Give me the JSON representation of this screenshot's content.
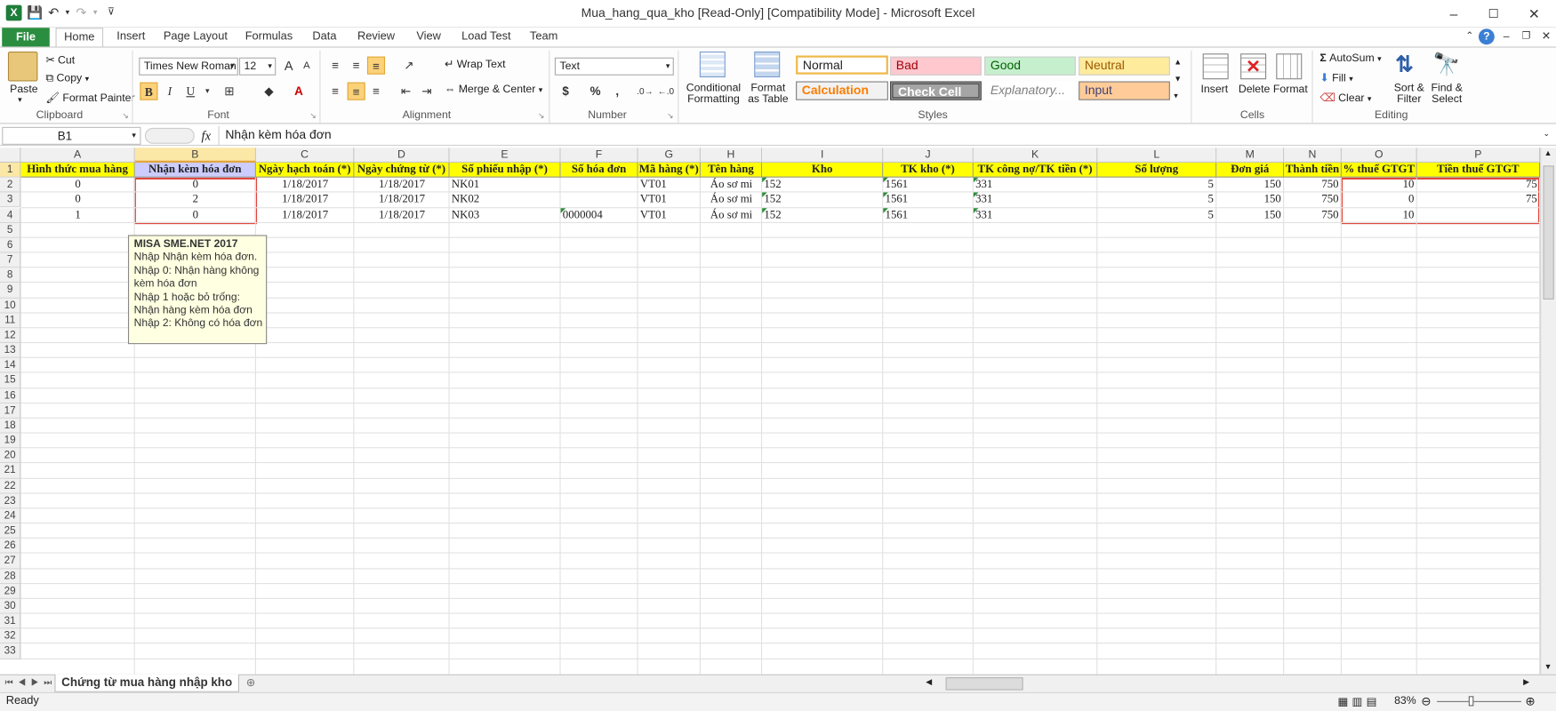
{
  "window": {
    "title": "Mua_hang_qua_kho  [Read-Only]  [Compatibility Mode]  -  Microsoft Excel"
  },
  "tabs": [
    "File",
    "Home",
    "Insert",
    "Page Layout",
    "Formulas",
    "Data",
    "Review",
    "View",
    "Load Test",
    "Team"
  ],
  "ribbon": {
    "clipboard": {
      "paste": "Paste",
      "cut": "Cut",
      "copy": "Copy",
      "format_painter": "Format Painter",
      "label": "Clipboard"
    },
    "font": {
      "name": "Times New Roman",
      "size": "12",
      "bold": "B",
      "italic": "I",
      "underline": "U",
      "label": "Font"
    },
    "alignment": {
      "wrap_text": "Wrap Text",
      "merge_center": "Merge & Center",
      "label": "Alignment"
    },
    "number": {
      "format": "Text",
      "currency": "$",
      "percent": "%",
      "comma": ",",
      "label": "Number"
    },
    "styles": {
      "conditional": "Conditional",
      "conditional2": "Formatting",
      "format_as": "Format",
      "format_as2": "as Table",
      "normal": "Normal",
      "bad": "Bad",
      "good": "Good",
      "neutral": "Neutral",
      "calculation": "Calculation",
      "check_cell": "Check Cell",
      "explanatory": "Explanatory...",
      "input": "Input",
      "label": "Styles"
    },
    "cells": {
      "insert": "Insert",
      "delete": "Delete",
      "format": "Format",
      "label": "Cells"
    },
    "editing": {
      "autosum": "AutoSum",
      "fill": "Fill",
      "clear": "Clear",
      "sort": "Sort &",
      "sort2": "Filter",
      "find": "Find &",
      "find2": "Select",
      "label": "Editing"
    }
  },
  "formula_bar": {
    "name_box": "B1",
    "fx": "fx",
    "content": "Nhận kèm hóa đơn"
  },
  "columns": [
    "A",
    "B",
    "C",
    "D",
    "E",
    "F",
    "G",
    "H",
    "I",
    "J",
    "K",
    "L",
    "M",
    "N",
    "O",
    "P"
  ],
  "rows": [
    "1",
    "2",
    "3",
    "4",
    "5",
    "6",
    "7",
    "8",
    "9",
    "10",
    "11",
    "12",
    "13",
    "14",
    "15",
    "16",
    "17",
    "18",
    "19",
    "20",
    "21",
    "22",
    "23",
    "24",
    "25",
    "26",
    "27",
    "28",
    "29",
    "30",
    "31",
    "32",
    "33"
  ],
  "header_row": [
    "Hình thức mua hàng",
    "Nhận kèm hóa đơn",
    "Ngày hạch toán (*)",
    "Ngày chứng từ (*)",
    "Số phiếu nhập (*)",
    "Số hóa đơn",
    "Mã hàng (*)",
    "Tên hàng",
    "Kho",
    "TK kho (*)",
    "TK công nợ/TK tiền (*)",
    "Số lượng",
    "Đơn giá",
    "Thành tiền",
    "% thuế GTGT",
    "Tiền thuế GTGT"
  ],
  "data_rows": [
    [
      "0",
      "0",
      "1/18/2017",
      "1/18/2017",
      "NK01",
      "",
      "VT01",
      "Áo sơ mi",
      "152",
      "1561",
      "331",
      "5",
      "150",
      "750",
      "10",
      "75"
    ],
    [
      "0",
      "2",
      "1/18/2017",
      "1/18/2017",
      "NK02",
      "",
      "VT01",
      "Áo sơ mi",
      "152",
      "1561",
      "331",
      "5",
      "150",
      "750",
      "0",
      "75"
    ],
    [
      "1",
      "0",
      "1/18/2017",
      "1/18/2017",
      "NK03",
      "0000004",
      "VT01",
      "Áo sơ mi",
      "152",
      "1561",
      "331",
      "5",
      "150",
      "750",
      "10",
      ""
    ]
  ],
  "comment": {
    "title": "MISA SME.NET 2017",
    "lines": [
      "Nhập Nhận kèm hóa đơn.",
      "Nhập 0: Nhận hàng không",
      "kèm hóa đơn",
      "Nhập 1 hoặc bỏ trống:",
      "Nhận hàng kèm hóa đơn",
      "Nhập 2: Không có hóa đơn"
    ]
  },
  "sheet_tab": "Chứng từ mua hàng nhập kho",
  "status": {
    "ready": "Ready",
    "zoom": "83%"
  },
  "colors": {
    "header_fill": "#ffff00",
    "selected_header_fill": "#ccccff",
    "highlight_box": "#e0443a",
    "file_tab": "#2a8d3f"
  }
}
